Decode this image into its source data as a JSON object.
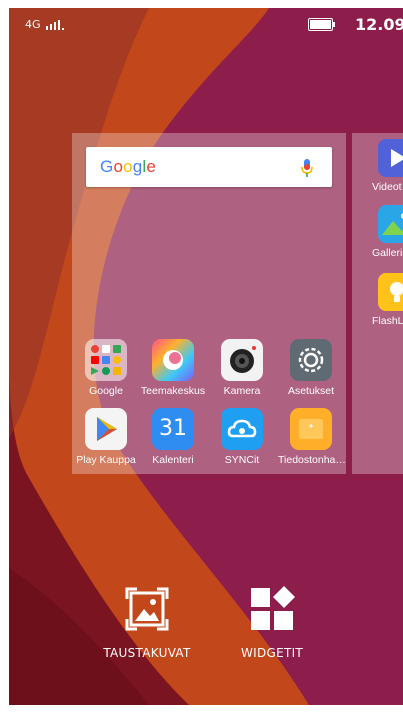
{
  "status_bar": {
    "network": "4G",
    "time": "12.09"
  },
  "search_widget": {
    "logo": "Google",
    "logo_colors": [
      "#4285F4",
      "#EA4335",
      "#FBBC05",
      "#4285F4",
      "#34A853",
      "#EA4335"
    ]
  },
  "home_apps": [
    {
      "label": "Google",
      "icon": "google-folder-icon"
    },
    {
      "label": "Teemakeskus",
      "icon": "theme-center-icon"
    },
    {
      "label": "Kamera",
      "icon": "camera-icon"
    },
    {
      "label": "Asetukset",
      "icon": "settings-gear-icon"
    },
    {
      "label": "Play Kauppa",
      "icon": "play-store-icon"
    },
    {
      "label": "Kalenteri",
      "icon": "calendar-icon",
      "day": "31"
    },
    {
      "label": "SYNCit",
      "icon": "syncit-cloud-icon"
    },
    {
      "label": "Tiedostonha…",
      "icon": "file-manager-icon"
    }
  ],
  "next_page_apps": [
    {
      "label": "Videot",
      "icon": "video-play-icon"
    },
    {
      "label": "Galleria",
      "icon": "gallery-icon"
    },
    {
      "label": "FlashLig",
      "icon": "flashlight-icon"
    }
  ],
  "bottom_actions": {
    "wallpapers": "TAUSTAKUVAT",
    "widgets": "WIDGETIT"
  },
  "colors": {
    "wallpaper_dark_red": "#7a1420",
    "wallpaper_magenta": "#8e1e4c",
    "wallpaper_orange": "#c24a1c"
  }
}
